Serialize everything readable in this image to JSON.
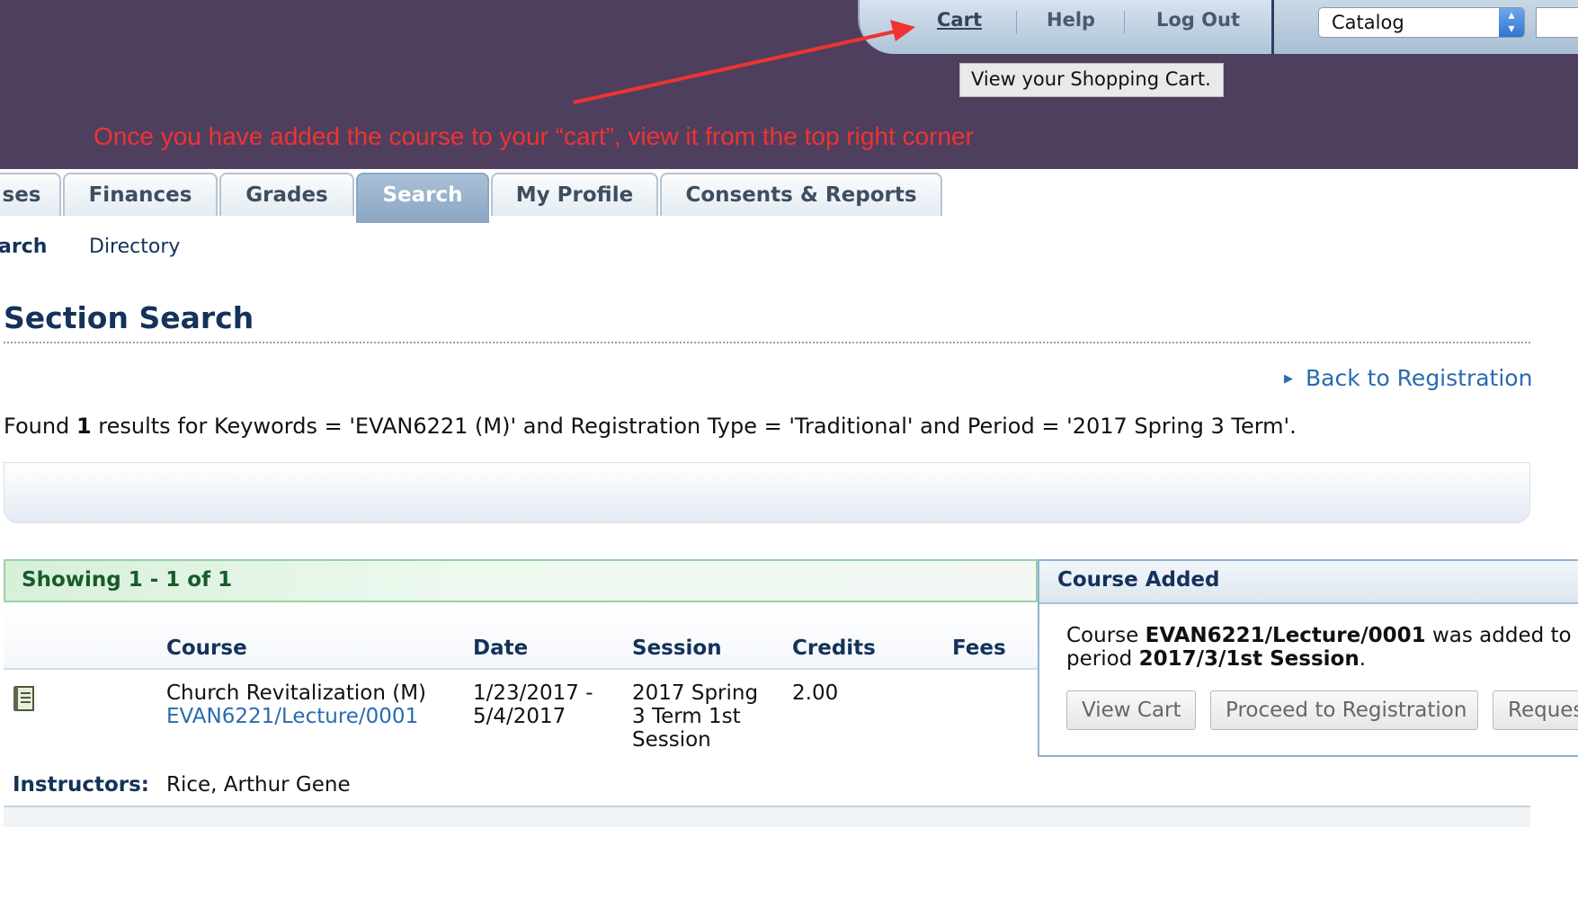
{
  "header": {
    "top_links": {
      "cart": "Cart",
      "help": "Help",
      "logout": "Log Out"
    },
    "catalog_select": "Catalog",
    "tooltip": "View your Shopping Cart.",
    "annotation": "Once you have added the course to your “cart”, view it from the top right corner"
  },
  "tabs": [
    {
      "label": "ses"
    },
    {
      "label": "Finances"
    },
    {
      "label": "Grades"
    },
    {
      "label": "Search"
    },
    {
      "label": "My Profile"
    },
    {
      "label": "Consents & Reports"
    }
  ],
  "subnav": {
    "item1": "arch",
    "item2": "Directory"
  },
  "page": {
    "title": "Section Search",
    "back_link": "Back to Registration",
    "found": {
      "prefix": "Found",
      "count": "1",
      "suffix": "results for Keywords = 'EVAN6221 (M)' and Registration Type = 'Traditional' and Period = '2017 Spring 3 Term'."
    }
  },
  "results": {
    "showing": "Showing 1 - 1 of 1",
    "columns": {
      "course": "Course",
      "date": "Date",
      "session": "Session",
      "credits": "Credits",
      "fees": "Fees"
    },
    "row": {
      "course_name": "Church Revitalization (M)",
      "course_link": "EVAN6221/Lecture/0001",
      "date_line1": "1/23/2017 -",
      "date_line2": "5/4/2017",
      "session_line1": "2017 Spring",
      "session_line2": "3 Term 1st",
      "session_line3": "Session",
      "credits": "2.00",
      "instructors_label": "Instructors:",
      "instructors": "Rice, Arthur Gene"
    }
  },
  "course_added": {
    "title": "Course Added",
    "line1_prefix": "Course",
    "line1_course": "EVAN6221/Lecture/0001",
    "line1_suffix": "was added to",
    "line2_prefix": "period",
    "line2_period": "2017/3/1st Session",
    "line2_suffix": ".",
    "buttons": {
      "view_cart": "View Cart",
      "proceed": "Proceed to Registration",
      "request": "Reques"
    }
  },
  "colors": {
    "header_bg": "#4e3f5e",
    "annotation": "#ee3333",
    "title": "#14325a",
    "link": "#2a6ab0",
    "showing_bar": "#d6f0da"
  }
}
